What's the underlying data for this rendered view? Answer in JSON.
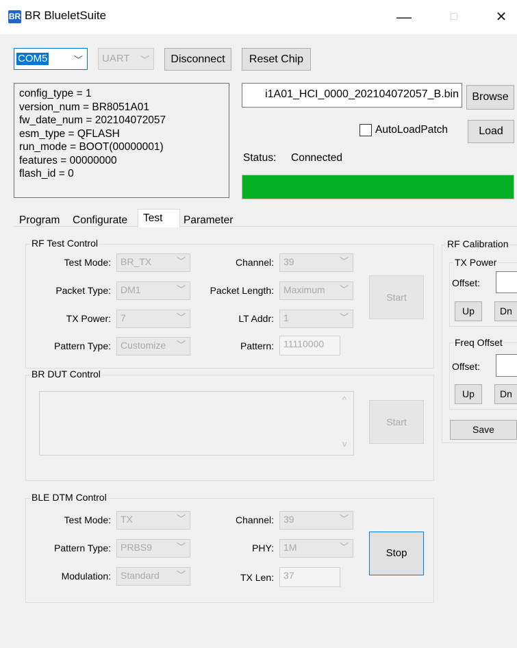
{
  "window": {
    "title": "BR BlueletSuite",
    "icon_text": "BR",
    "minimize_glyph": "—",
    "maximize_glyph": "□",
    "close_glyph": "✕"
  },
  "connection": {
    "port_value": "COM5",
    "interface_value": "UART",
    "disconnect_label": "Disconnect",
    "reset_chip_label": "Reset Chip"
  },
  "info_lines": [
    "config_type = 1",
    "version_num = BR8051A01",
    "fw_date_num = 202104072057",
    "esm_type = QFLASH",
    "run_mode = BOOT(00000001)",
    "features = 00000000",
    "flash_id = 0"
  ],
  "patch": {
    "file_value": "i1A01_HCI_0000_202104072057_B.bin",
    "browse_label": "Browse",
    "autoload_label": "AutoLoadPatch",
    "autoload_checked": false,
    "load_label": "Load",
    "status_label": "Status:",
    "status_value": "Connected",
    "progress_fraction": 1.0,
    "progress_color": "#06b025"
  },
  "tabs": [
    "Program",
    "Configurate",
    "Test",
    "Parameter"
  ],
  "active_tab": "Test",
  "rf_test": {
    "title": "RF Test Control",
    "test_mode_label": "Test Mode:",
    "test_mode_value": "BR_TX",
    "channel_label": "Channel:",
    "channel_value": "39",
    "packet_type_label": "Packet Type:",
    "packet_type_value": "DM1",
    "packet_length_label": "Packet Length:",
    "packet_length_value": "Maximum",
    "tx_power_label": "TX Power:",
    "tx_power_value": "7",
    "lt_addr_label": "LT Addr:",
    "lt_addr_value": "1",
    "pattern_type_label": "Pattern Type:",
    "pattern_type_value": "Customize",
    "pattern_label": "Pattern:",
    "pattern_value": "11110000",
    "start_label": "Start"
  },
  "br_dut": {
    "title": "BR DUT Control",
    "start_label": "Start",
    "scroll_up_glyph": "^",
    "scroll_down_glyph": "v"
  },
  "ble_dtm": {
    "title": "BLE DTM Control",
    "test_mode_label": "Test Mode:",
    "test_mode_value": "TX",
    "channel_label": "Channel:",
    "channel_value": "39",
    "pattern_type_label": "Pattern Type:",
    "pattern_type_value": "PRBS9",
    "phy_label": "PHY:",
    "phy_value": "1M",
    "modulation_label": "Modulation:",
    "modulation_value": "Standard",
    "tx_len_label": "TX Len:",
    "tx_len_value": "37",
    "stop_label": "Stop"
  },
  "rf_calibration": {
    "title": "RF Calibration",
    "tx_power_title": "TX Power",
    "tx_offset_label": "Offset:",
    "tx_up_label": "Up",
    "tx_dn_label": "Dn",
    "freq_offset_title": "Freq Offset",
    "freq_offset_label": "Offset:",
    "freq_up_label": "Up",
    "freq_dn_label": "Dn",
    "save_label": "Save"
  },
  "icons": {
    "combo_arrow": "chevron-down-icon"
  },
  "colors": {
    "accent": "#0078d7",
    "selection": "#0078d7",
    "progress": "#06b025"
  }
}
